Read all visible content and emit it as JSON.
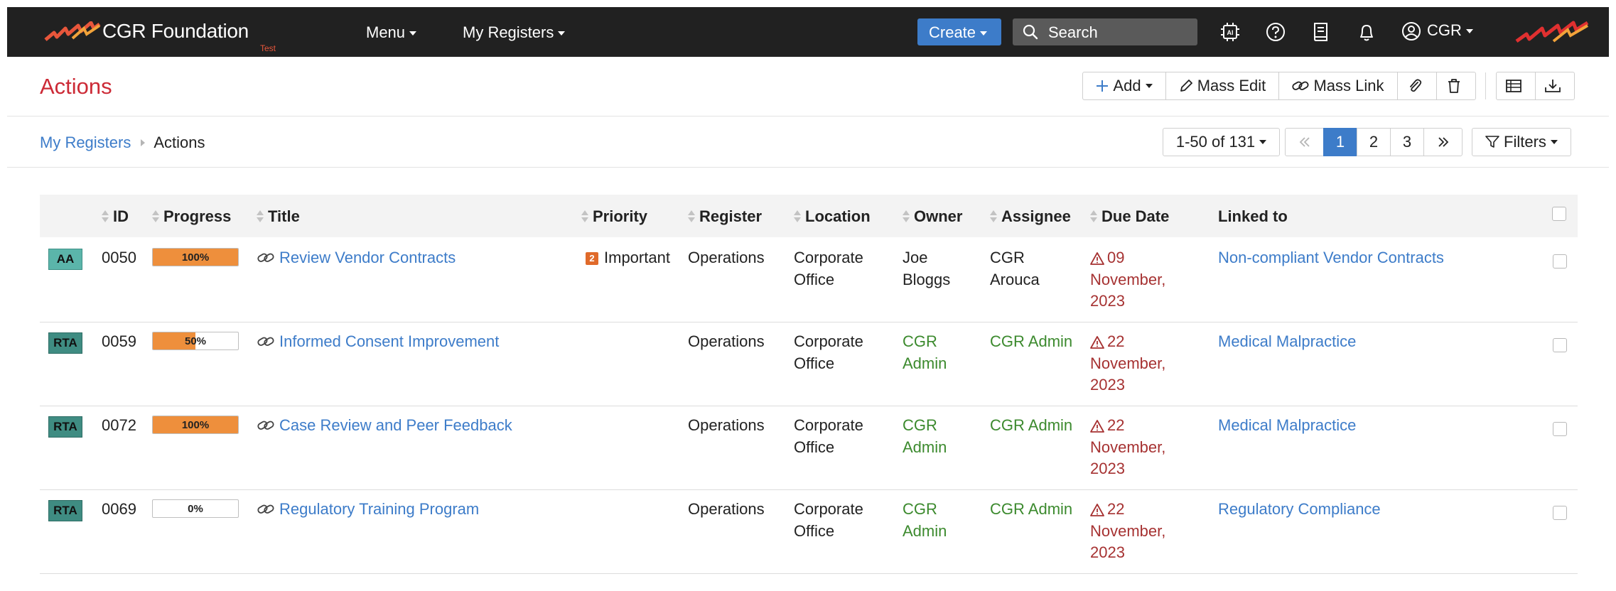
{
  "nav": {
    "brand": "CGR Foundation",
    "brand_sub": "Test",
    "menu_label": "Menu",
    "registers_label": "My Registers",
    "create_label": "Create",
    "search_label": "Search",
    "user_label": "CGR"
  },
  "header": {
    "title": "Actions",
    "add_label": "Add",
    "mass_edit_label": "Mass Edit",
    "mass_link_label": "Mass Link"
  },
  "breadcrumb": {
    "parent": "My Registers",
    "current": "Actions"
  },
  "pager": {
    "range_label": "1-50 of 131",
    "pages": [
      "1",
      "2",
      "3"
    ],
    "current_page": "1",
    "filters_label": "Filters"
  },
  "table": {
    "columns": {
      "id": "ID",
      "progress": "Progress",
      "title": "Title",
      "priority": "Priority",
      "register": "Register",
      "location": "Location",
      "owner": "Owner",
      "assignee": "Assignee",
      "due_date": "Due Date",
      "linked_to": "Linked to"
    },
    "rows": [
      {
        "type": "AA",
        "id": "0050",
        "progress_label": "100%",
        "progress_value": 1.0,
        "title": "Review Vendor Contracts",
        "priority_code": "2",
        "priority": "Important",
        "register": "Operations",
        "location_1": "Corporate",
        "location_2": "Office",
        "owner_1": "Joe",
        "owner_2": "Bloggs",
        "assignee_1": "CGR",
        "assignee_2": "Arouca",
        "due_1": "09",
        "due_2": "November,",
        "due_3": "2023",
        "linked_to": "Non-compliant Vendor Contracts"
      },
      {
        "type": "RTA",
        "id": "0059",
        "progress_label": "50%",
        "progress_value": 0.5,
        "title": "Informed Consent Improvement",
        "priority_code": "",
        "priority": "",
        "register": "Operations",
        "location_1": "Corporate",
        "location_2": "Office",
        "owner_1": "CGR",
        "owner_2": "Admin",
        "assignee_1": "CGR Admin",
        "assignee_2": "",
        "due_1": "22",
        "due_2": "November,",
        "due_3": "2023",
        "linked_to": "Medical Malpractice"
      },
      {
        "type": "RTA",
        "id": "0072",
        "progress_label": "100%",
        "progress_value": 1.0,
        "title": "Case Review and Peer Feedback",
        "priority_code": "",
        "priority": "",
        "register": "Operations",
        "location_1": "Corporate",
        "location_2": "Office",
        "owner_1": "CGR",
        "owner_2": "Admin",
        "assignee_1": "CGR Admin",
        "assignee_2": "",
        "due_1": "22",
        "due_2": "November,",
        "due_3": "2023",
        "linked_to": "Medical Malpractice"
      },
      {
        "type": "RTA",
        "id": "0069",
        "progress_label": "0%",
        "progress_value": 0.0,
        "title": "Regulatory Training Program",
        "priority_code": "",
        "priority": "",
        "register": "Operations",
        "location_1": "Corporate",
        "location_2": "Office",
        "owner_1": "CGR",
        "owner_2": "Admin",
        "assignee_1": "CGR Admin",
        "assignee_2": "",
        "due_1": "22",
        "due_2": "November,",
        "due_3": "2023",
        "linked_to": "Regulatory Compliance"
      }
    ]
  },
  "colors": {
    "topbar": "#212121",
    "accent_blue": "#3d7cc9",
    "title_red": "#cc2a36",
    "progress_orange": "#ee8f3c",
    "due_red": "#a63232",
    "owner_green": "#3c8a2e",
    "badge_teal": "#5bb5aa"
  },
  "icons": [
    "brand-logo",
    "search-icon",
    "ai-chip-icon",
    "help-icon",
    "book-icon",
    "bell-icon",
    "user-circle-icon",
    "brand-mark-icon",
    "plus-icon",
    "pencil-icon",
    "link-icon",
    "paperclip-icon",
    "trash-icon",
    "table-view-icon",
    "download-icon",
    "double-chevron-left-icon",
    "double-chevron-right-icon",
    "filter-icon",
    "sort-icon",
    "warning-icon"
  ]
}
